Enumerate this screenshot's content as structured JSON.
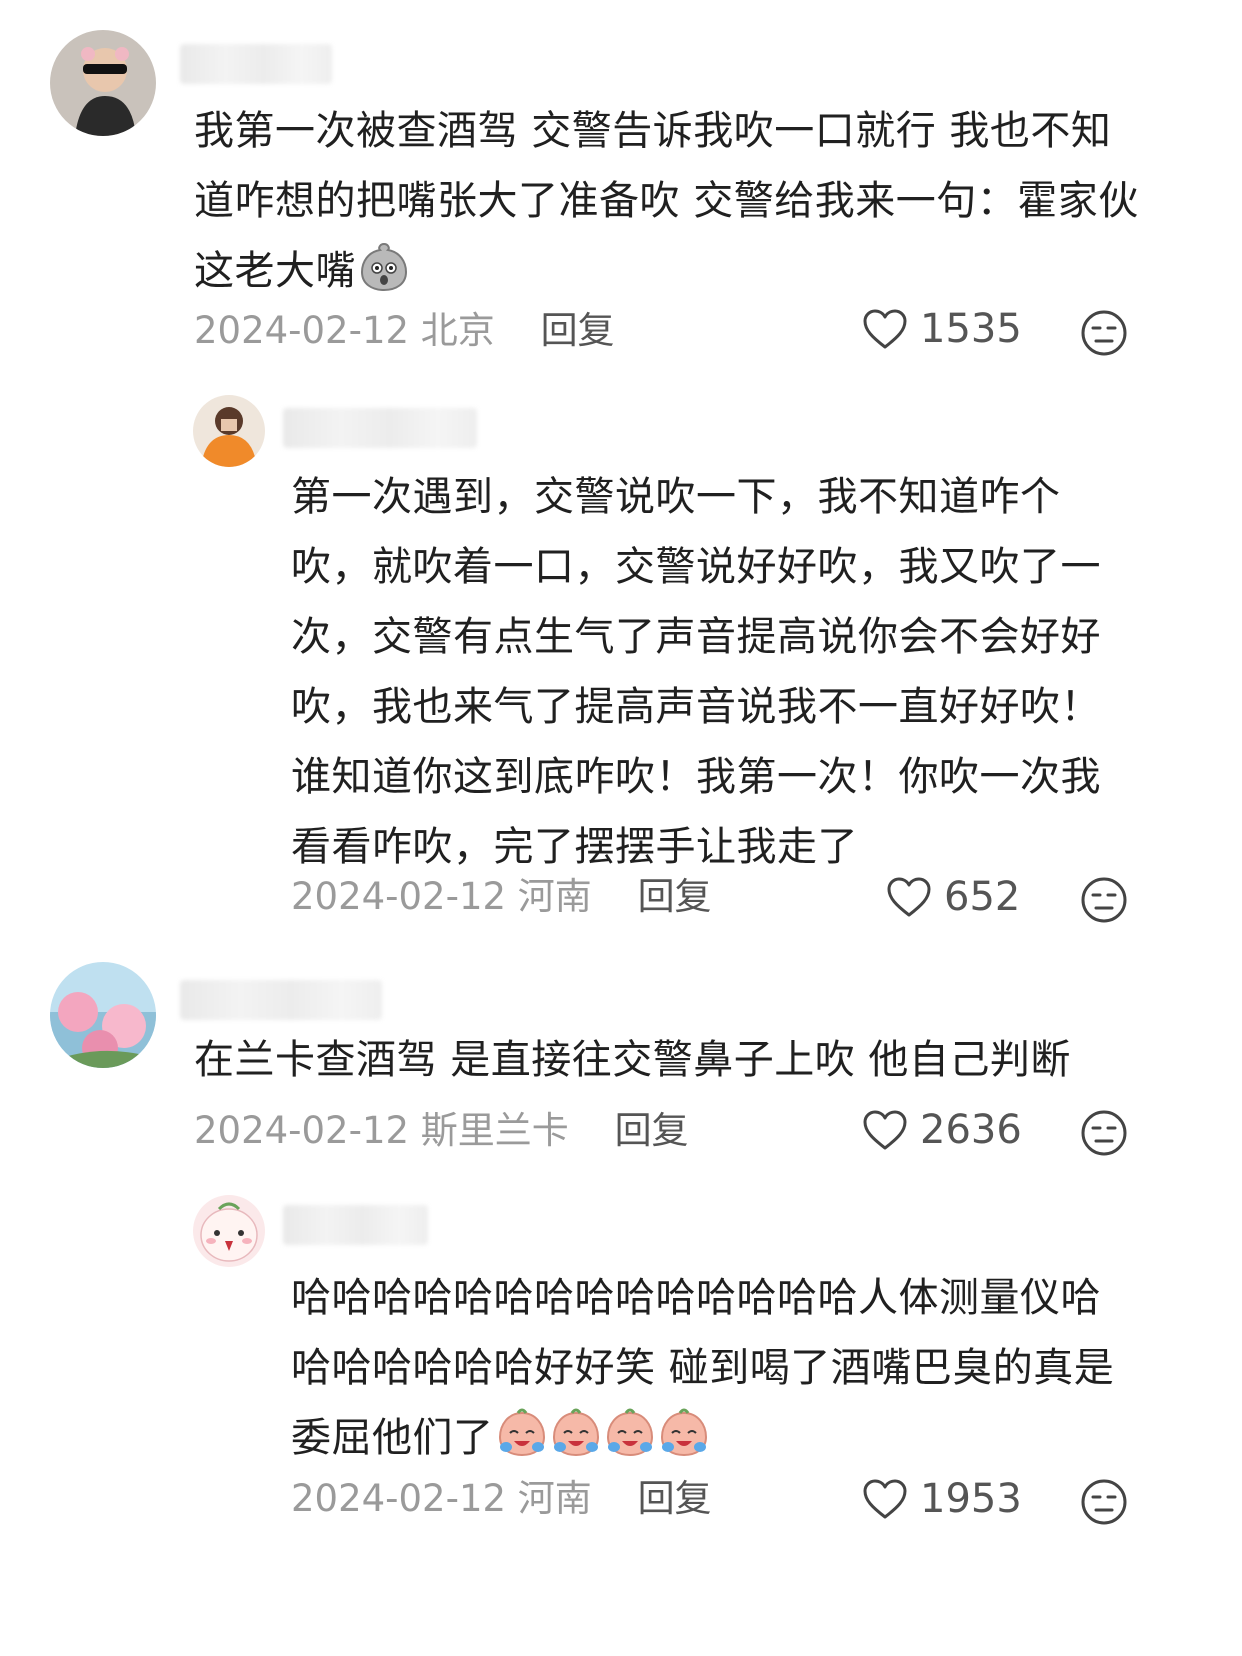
{
  "comments": [
    {
      "text": "我第一次被查酒驾 交警告诉我吹一口就行 我也不知道咋想的把嘴张大了准备吹 交警给我来一句：霍家伙 这老大嘴",
      "date": "2024-02-12",
      "location": "北京",
      "reply_label": "回复",
      "likes": "1535",
      "emoji_icon": "shocked-face-icon",
      "replies": [
        {
          "text": "第一次遇到，交警说吹一下，我不知道咋个吹，就吹着一口，交警说好好吹，我又吹了一次，交警有点生气了声音提高说你会不会好好吹，我也来气了提高声音说我不一直好好吹！谁知道你这到底咋吹！我第一次！你吹一次我看看咋吹，完了摆摆手让我走了",
          "date": "2024-02-12",
          "location": "河南",
          "reply_label": "回复",
          "likes": "652"
        }
      ]
    },
    {
      "text": "在兰卡查酒驾 是直接往交警鼻子上吹 他自己判断",
      "date": "2024-02-12",
      "location": "斯里兰卡",
      "reply_label": "回复",
      "likes": "2636",
      "replies": [
        {
          "text": "哈哈哈哈哈哈哈哈哈哈哈哈哈哈人体测量仪哈哈哈哈哈哈哈好好笑 碰到喝了酒嘴巴臭的真是委屈他们了",
          "date": "2024-02-12",
          "location": "河南",
          "reply_label": "回复",
          "likes": "1953",
          "emoji_icon": "crying-laughing-icon"
        }
      ]
    }
  ],
  "icons": {
    "like": "heart-outline-icon",
    "dislike": "neutral-face-icon"
  },
  "colors": {
    "text": "#202020",
    "meta": "#9a9a9a",
    "reply": "#555555"
  }
}
